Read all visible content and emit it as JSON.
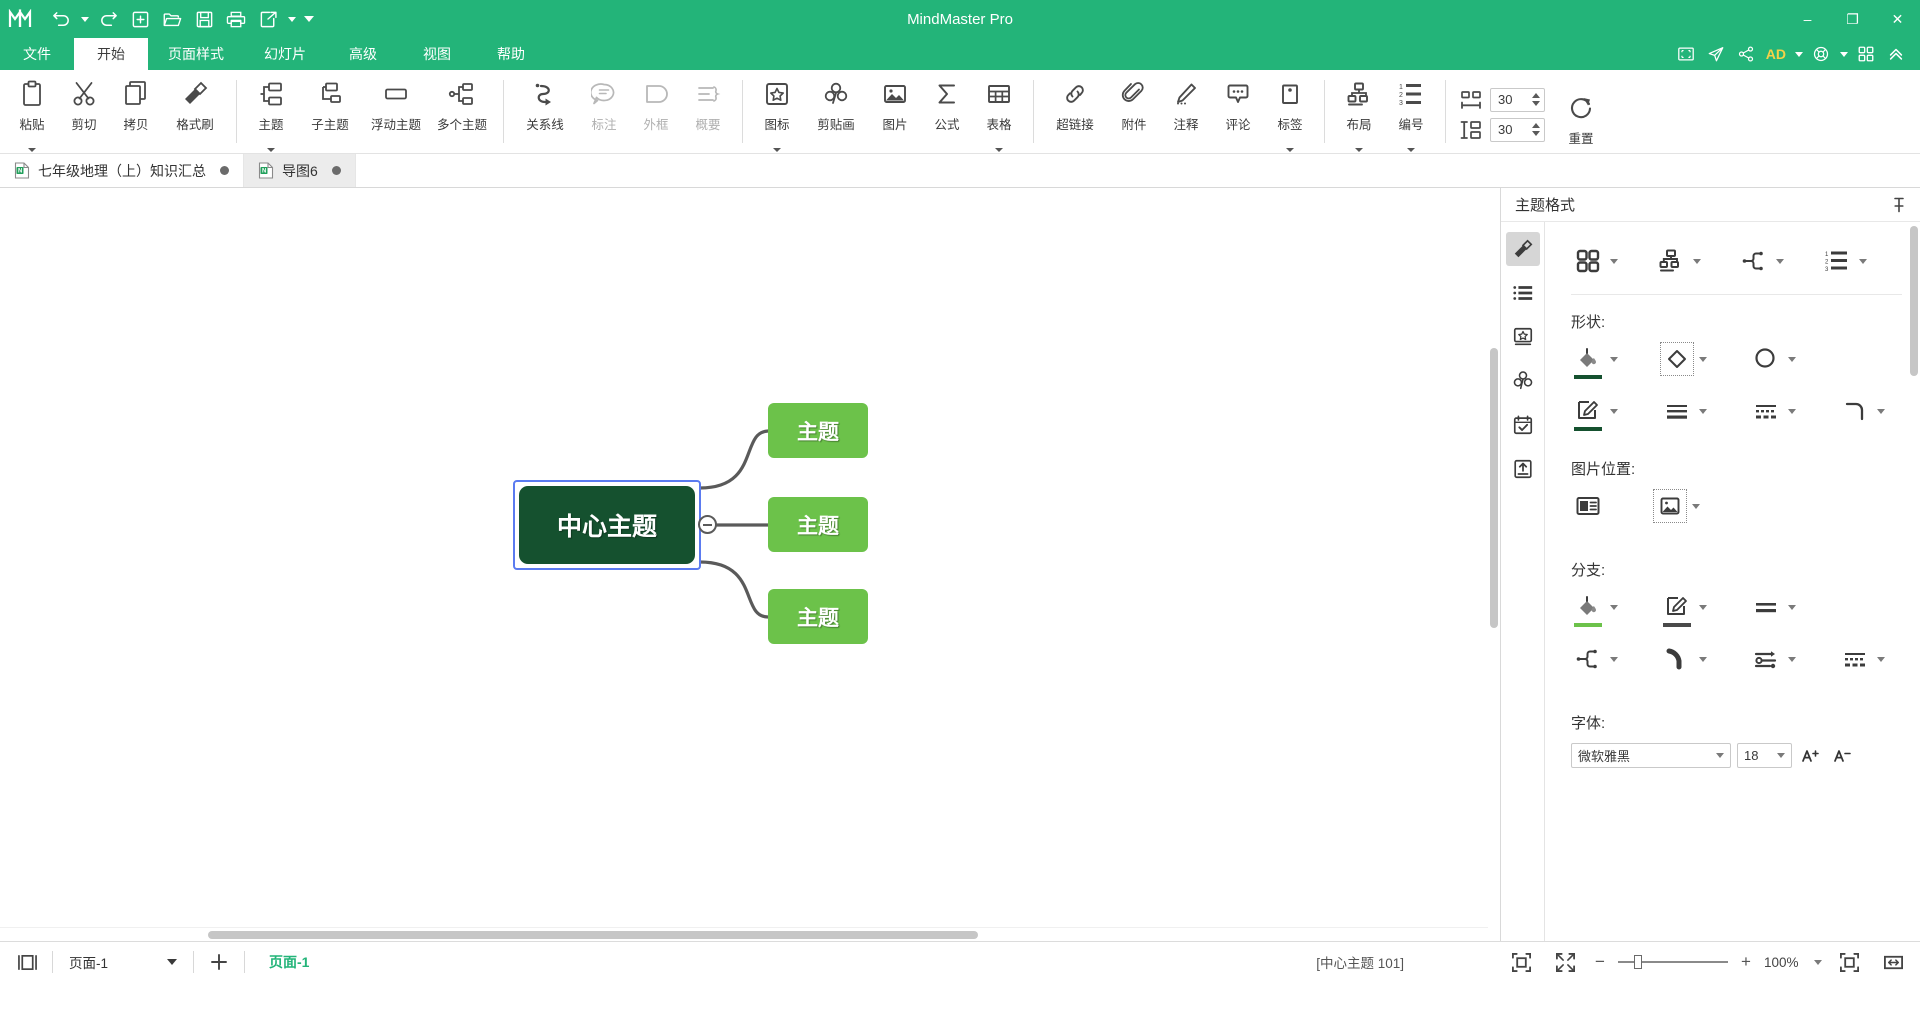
{
  "window": {
    "title": "MindMaster Pro",
    "logo": "mindmaster-logo",
    "minimize": "–",
    "maximize": "❐",
    "close": "✕"
  },
  "quick_access": [
    {
      "name": "undo-icon",
      "label": "撤销"
    },
    {
      "name": "redo-icon",
      "label": "重做"
    },
    {
      "name": "new-icon",
      "label": "新建"
    },
    {
      "name": "open-icon",
      "label": "打开"
    },
    {
      "name": "save-icon",
      "label": "保存"
    },
    {
      "name": "print-icon",
      "label": "打印"
    },
    {
      "name": "export-icon",
      "label": "导出"
    }
  ],
  "menubar": {
    "items": [
      {
        "label": "文件",
        "active": false
      },
      {
        "label": "开始",
        "active": true
      },
      {
        "label": "页面样式",
        "active": false
      },
      {
        "label": "幻灯片",
        "active": false
      },
      {
        "label": "高级",
        "active": false
      },
      {
        "label": "视图",
        "active": false
      },
      {
        "label": "帮助",
        "active": false
      }
    ],
    "right_icons": [
      {
        "name": "presentation-icon"
      },
      {
        "name": "send-icon"
      },
      {
        "name": "share-icon"
      }
    ],
    "account_badge": "AD",
    "help_icon": "lifebuoy-icon",
    "grid_icon": "apps-grid-icon",
    "collapse_icon": "collapse-ribbon-icon"
  },
  "ribbon": {
    "groups": [
      {
        "name": "clipboard",
        "buttons": [
          {
            "label": "粘贴",
            "icon": "paste-icon",
            "caret": true,
            "disabled": false
          },
          {
            "label": "剪切",
            "icon": "cut-icon",
            "caret": false,
            "disabled": false
          },
          {
            "label": "拷贝",
            "icon": "copy-icon",
            "caret": false,
            "disabled": false
          },
          {
            "label": "格式刷",
            "icon": "format-painter-icon",
            "caret": false,
            "disabled": false
          }
        ]
      },
      {
        "name": "topics",
        "buttons": [
          {
            "label": "主题",
            "icon": "topic-icon",
            "caret": true,
            "disabled": false
          },
          {
            "label": "子主题",
            "icon": "subtopic-icon",
            "caret": false,
            "disabled": false
          },
          {
            "label": "浮动主题",
            "icon": "floating-topic-icon",
            "caret": false,
            "disabled": false
          },
          {
            "label": "多个主题",
            "icon": "multi-topic-icon",
            "caret": false,
            "disabled": false
          }
        ]
      },
      {
        "name": "relations",
        "buttons": [
          {
            "label": "关系线",
            "icon": "relationship-line-icon",
            "caret": false,
            "disabled": false
          },
          {
            "label": "标注",
            "icon": "callout-icon",
            "caret": false,
            "disabled": true
          },
          {
            "label": "外框",
            "icon": "boundary-icon",
            "caret": false,
            "disabled": true
          },
          {
            "label": "概要",
            "icon": "summary-icon",
            "caret": false,
            "disabled": true
          }
        ]
      },
      {
        "name": "insert",
        "buttons": [
          {
            "label": "图标",
            "icon": "icon-star-icon",
            "caret": true,
            "disabled": false
          },
          {
            "label": "剪贴画",
            "icon": "clipart-icon",
            "caret": false,
            "disabled": false
          },
          {
            "label": "图片",
            "icon": "picture-icon",
            "caret": false,
            "disabled": false
          },
          {
            "label": "公式",
            "icon": "formula-sigma-icon",
            "caret": false,
            "disabled": false
          },
          {
            "label": "表格",
            "icon": "table-icon",
            "caret": true,
            "disabled": false
          }
        ]
      },
      {
        "name": "annotate",
        "buttons": [
          {
            "label": "超链接",
            "icon": "hyperlink-icon",
            "caret": false,
            "disabled": false
          },
          {
            "label": "附件",
            "icon": "attachment-icon",
            "caret": false,
            "disabled": false
          },
          {
            "label": "注释",
            "icon": "note-pencil-icon",
            "caret": false,
            "disabled": false
          },
          {
            "label": "评论",
            "icon": "comment-icon",
            "caret": false,
            "disabled": false
          },
          {
            "label": "标签",
            "icon": "tag-icon",
            "caret": true,
            "disabled": false
          }
        ]
      },
      {
        "name": "arrange",
        "buttons": [
          {
            "label": "布局",
            "icon": "layout-icon",
            "caret": true,
            "disabled": false
          },
          {
            "label": "编号",
            "icon": "numbering-icon",
            "caret": true,
            "disabled": false
          }
        ]
      }
    ],
    "spacing": {
      "horizontal_icon": "horizontal-spacing-icon",
      "horizontal_value": "30",
      "vertical_icon": "vertical-spacing-icon",
      "vertical_value": "30",
      "reset_label": "重置",
      "reset_icon": "reset-circular-arrow-icon"
    }
  },
  "doc_tabs": [
    {
      "label": "七年级地理（上）知识汇总",
      "active": true,
      "modified": true,
      "icon": "mindmap-file-icon"
    },
    {
      "label": "导图6",
      "active": false,
      "modified": true,
      "icon": "mindmap-file-icon"
    }
  ],
  "mindmap": {
    "central": {
      "text": "中心主题",
      "selected": true,
      "fill": "#15512f",
      "text_color": "#ffffff"
    },
    "branches": [
      {
        "text": "主题",
        "fill": "#6cc24a",
        "text_color": "#ffffff"
      },
      {
        "text": "主题",
        "fill": "#6cc24a",
        "text_color": "#ffffff"
      },
      {
        "text": "主题",
        "fill": "#6cc24a",
        "text_color": "#ffffff"
      }
    ],
    "collapse_toggle": {
      "name": "collapse-toggle",
      "state": "expanded",
      "glyph": "−"
    },
    "branch_line_color": "#5a5a5a",
    "selection_color": "#5b7bf0"
  },
  "right_panel": {
    "title": "主题格式",
    "pin_icon": "pin-icon",
    "rail": [
      {
        "name": "style-brush-icon",
        "active": true
      },
      {
        "name": "outline-list-icon",
        "active": false
      },
      {
        "name": "icon-library-icon",
        "active": false
      },
      {
        "name": "clipart-library-icon",
        "active": false
      },
      {
        "name": "task-calendar-icon",
        "active": false
      },
      {
        "name": "export-upload-icon",
        "active": false
      }
    ],
    "top_tools": [
      {
        "name": "theme-grid-icon",
        "caret": true
      },
      {
        "name": "layout-structure-icon",
        "caret": true
      },
      {
        "name": "branch-shape-icon",
        "caret": true
      },
      {
        "name": "numbering-style-icon",
        "caret": true
      }
    ],
    "sections": [
      {
        "label": "形状:",
        "rows": [
          [
            {
              "name": "fill-color-icon",
              "caret": true,
              "underline": "#15512f"
            },
            {
              "name": "shape-picker-icon",
              "caret": true,
              "dotted": true
            },
            {
              "name": "shadow-effect-icon",
              "caret": true
            }
          ],
          [
            {
              "name": "line-color-icon",
              "caret": true,
              "underline": "#15512f"
            },
            {
              "name": "line-weight-icon",
              "caret": true
            },
            {
              "name": "line-dash-icon",
              "caret": true
            },
            {
              "name": "corner-radius-icon",
              "caret": true
            }
          ]
        ]
      },
      {
        "label": "图片位置:",
        "rows": [
          [
            {
              "name": "image-position-icon",
              "caret": false
            },
            {
              "name": "image-align-icon",
              "caret": true,
              "dotted": true
            }
          ]
        ]
      },
      {
        "label": "分支:",
        "rows": [
          [
            {
              "name": "branch-fill-color-icon",
              "caret": true,
              "underline": "#6cc24a"
            },
            {
              "name": "branch-line-color-icon",
              "caret": true,
              "underline": "#4a4a4a"
            },
            {
              "name": "branch-weight-icon",
              "caret": true
            }
          ],
          [
            {
              "name": "branch-connector-icon",
              "caret": true
            },
            {
              "name": "branch-curve-icon",
              "caret": true
            },
            {
              "name": "branch-arrow-icon",
              "caret": true
            },
            {
              "name": "branch-dash-icon",
              "caret": true
            }
          ]
        ]
      },
      {
        "label": "字体:",
        "rows": []
      }
    ],
    "font": {
      "family": "微软雅黑",
      "size": "18",
      "increase_icon": "increase-font-icon",
      "decrease_icon": "decrease-font-icon"
    }
  },
  "status_bar": {
    "view_toggle_icon": "panel-toggle-icon",
    "page_select": "页面-1",
    "add_page_icon": "add-page-icon",
    "page_active": "页面-1",
    "status_text": "[中心主题 101]",
    "fit_page_icon": "fit-page-icon",
    "full_screen_icon": "full-screen-icon",
    "zoom_out": "−",
    "zoom_in": "+",
    "zoom_value": "100%",
    "fit_drawing_icon": "fit-drawing-icon",
    "fit_width_icon": "fit-width-icon"
  }
}
